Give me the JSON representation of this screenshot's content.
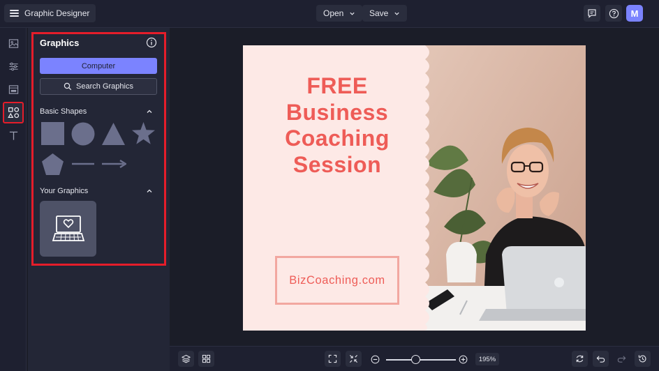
{
  "topbar": {
    "app_title": "Graphic Designer",
    "open_label": "Open",
    "save_label": "Save",
    "avatar_initial": "M",
    "icons": [
      "hamburger-icon",
      "chevron-down-icon",
      "chat-icon",
      "help-icon"
    ]
  },
  "left_rail": {
    "items": [
      {
        "name": "image-icon",
        "active": false
      },
      {
        "name": "adjustments-icon",
        "active": false
      },
      {
        "name": "layout-icon",
        "active": false
      },
      {
        "name": "graphics-icon",
        "active": true
      },
      {
        "name": "text-icon",
        "active": false
      }
    ]
  },
  "panel": {
    "title": "Graphics",
    "computer_label": "Computer",
    "search_label": "Search Graphics",
    "basic_shapes_label": "Basic Shapes",
    "your_graphics_label": "Your Graphics",
    "shapes": [
      "square",
      "circle",
      "triangle",
      "star",
      "pentagon",
      "line",
      "arrow"
    ],
    "your_graphics": [
      {
        "icon": "laptop-heart-icon"
      }
    ]
  },
  "design": {
    "headline_lines": [
      "FREE",
      "Business",
      "Coaching",
      "Session"
    ],
    "website": "BizCoaching.com",
    "colors": {
      "background": "#fde9e6",
      "text": "#ee5c57",
      "border": "#f2a7a0"
    }
  },
  "bottombar": {
    "zoom_level": "195%",
    "zoom_fraction": 0.42
  },
  "colors": {
    "accent": "#7b83ff",
    "highlight": "#e51d2a",
    "panel": "#232636",
    "topbar": "#1e2030"
  }
}
